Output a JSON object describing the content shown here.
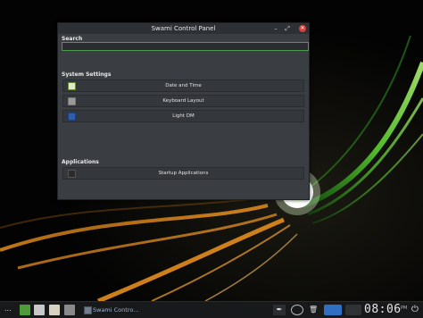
{
  "window": {
    "title": "Swami Control Panel",
    "search_label": "Search",
    "search_value": "",
    "system_settings_label": "System Settings",
    "system_items": [
      {
        "label": "Date and Time",
        "icon": "calendar-icon"
      },
      {
        "label": "Keyboard Layout",
        "icon": "keyboard-icon"
      },
      {
        "label": "Light DM",
        "icon": "monitor-icon"
      }
    ],
    "applications_label": "Applications",
    "application_items": [
      {
        "label": "Startup Applications",
        "icon": "startup-icon"
      }
    ]
  },
  "taskbar": {
    "menu_glyph": "...",
    "app_label": "Swami Contro...",
    "clock": "08:06",
    "ampm": "PM"
  },
  "colors": {
    "accent_green": "#4e9a4e",
    "close_red": "#d6413a",
    "window_bg": "#3a3d42"
  }
}
